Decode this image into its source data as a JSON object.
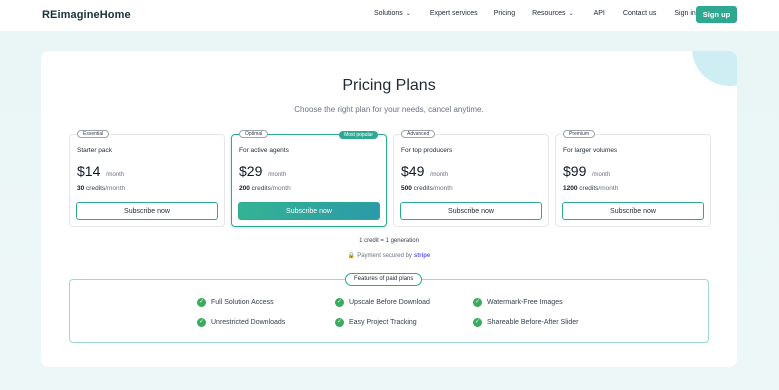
{
  "header": {
    "logo": "REimagineHome",
    "nav": [
      {
        "label": "Solutions",
        "dropdown": true
      },
      {
        "label": "Expert services",
        "dropdown": false
      },
      {
        "label": "Pricing",
        "dropdown": false
      },
      {
        "label": "Resources",
        "dropdown": true
      },
      {
        "label": "API",
        "dropdown": false
      },
      {
        "label": "Contact us",
        "dropdown": false
      },
      {
        "label": "Sign in",
        "dropdown": false
      }
    ],
    "signup": "Sign up"
  },
  "main": {
    "title": "Pricing Plans",
    "subtitle": "Choose the right plan for your needs, cancel anytime.",
    "plans": [
      {
        "tag": "Essential",
        "desc": "Starter pack",
        "price": "$14",
        "per": "/month",
        "credits": "30",
        "credits_word": "credits",
        "credits_per": "/month",
        "button": "Subscribe now"
      },
      {
        "tag": "Optimal",
        "badge": "Most popular",
        "desc": "For active agents",
        "price": "$29",
        "per": "/month",
        "credits": "200",
        "credits_word": "credits",
        "credits_per": "/month",
        "button": "Subscribe now"
      },
      {
        "tag": "Advanced",
        "desc": "For top producers",
        "price": "$49",
        "per": "/month",
        "credits": "500",
        "credits_word": "credits",
        "credits_per": "/month",
        "button": "Subscribe now"
      },
      {
        "tag": "Premium",
        "desc": "For larger volumes",
        "price": "$99",
        "per": "/month",
        "credits": "1200",
        "credits_word": "credits",
        "credits_per": "/month",
        "button": "Subscribe now"
      }
    ],
    "credit_note": "1 credit = 1 generation",
    "secured_text": "Payment secured by",
    "secured_brand": "stripe",
    "features": {
      "label": "Features of paid plans",
      "items": [
        "Full Solution Access",
        "Upscale Before Download",
        "Watermark-Free Images",
        "Unrestricted Downloads",
        "Easy Project Tracking",
        "Shareable Before-After Slider"
      ]
    }
  },
  "colors": {
    "accent": "#2fa892",
    "check": "#3aaa5c",
    "stripe": "#635bff"
  },
  "icons": [
    "chevron-down-icon",
    "lock-icon",
    "check-circle-icon"
  ]
}
